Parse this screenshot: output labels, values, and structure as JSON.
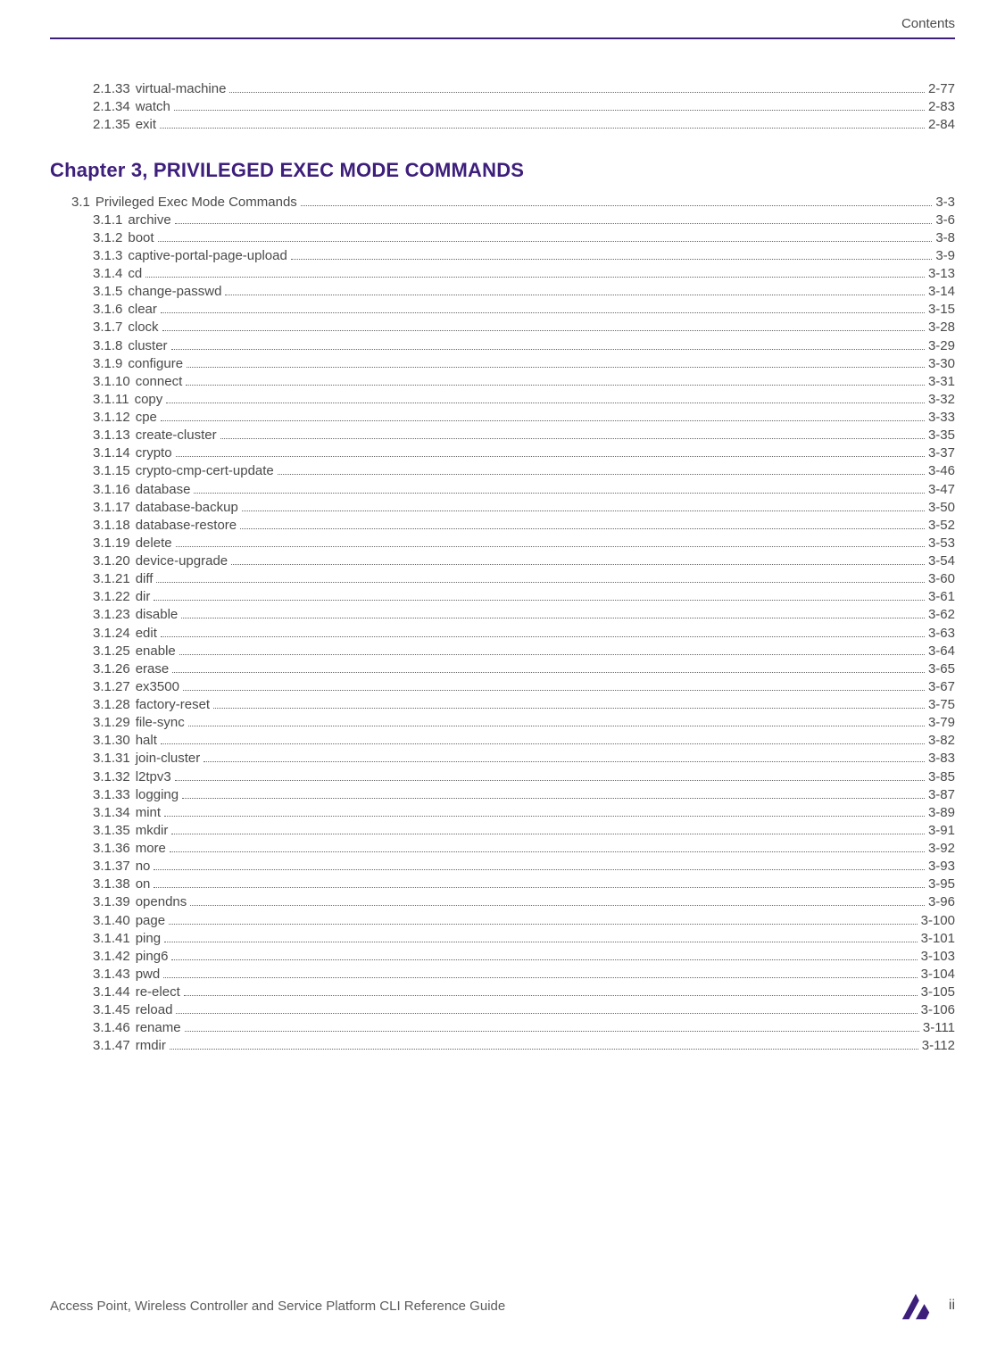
{
  "header": {
    "section_label": "Contents"
  },
  "chapter_heading": "Chapter 3, PRIVILEGED EXEC MODE COMMANDS",
  "toc_pre": [
    {
      "num": "2.1.33",
      "title": "virtual-machine",
      "page": "2-77",
      "indent": 2
    },
    {
      "num": "2.1.34",
      "title": "watch",
      "page": "2-83",
      "indent": 2
    },
    {
      "num": "2.1.35",
      "title": "exit",
      "page": "2-84",
      "indent": 2
    }
  ],
  "toc_post": [
    {
      "num": "3.1",
      "title": "Privileged Exec Mode Commands",
      "page": "3-3",
      "indent": 1
    },
    {
      "num": "3.1.1",
      "title": "archive",
      "page": "3-6",
      "indent": 2
    },
    {
      "num": "3.1.2",
      "title": "boot",
      "page": "3-8",
      "indent": 2
    },
    {
      "num": "3.1.3",
      "title": "captive-portal-page-upload",
      "page": "3-9",
      "indent": 2
    },
    {
      "num": "3.1.4",
      "title": "cd",
      "page": "3-13",
      "indent": 2
    },
    {
      "num": "3.1.5",
      "title": "change-passwd",
      "page": "3-14",
      "indent": 2
    },
    {
      "num": "3.1.6",
      "title": "clear",
      "page": "3-15",
      "indent": 2
    },
    {
      "num": "3.1.7",
      "title": "clock",
      "page": "3-28",
      "indent": 2
    },
    {
      "num": "3.1.8",
      "title": "cluster",
      "page": "3-29",
      "indent": 2
    },
    {
      "num": "3.1.9",
      "title": "configure",
      "page": "3-30",
      "indent": 2
    },
    {
      "num": "3.1.10",
      "title": "connect",
      "page": "3-31",
      "indent": 2
    },
    {
      "num": "3.1.11",
      "title": "copy",
      "page": "3-32",
      "indent": 2
    },
    {
      "num": "3.1.12",
      "title": "cpe",
      "page": "3-33",
      "indent": 2
    },
    {
      "num": "3.1.13",
      "title": "create-cluster",
      "page": "3-35",
      "indent": 2
    },
    {
      "num": "3.1.14",
      "title": "crypto",
      "page": "3-37",
      "indent": 2
    },
    {
      "num": "3.1.15",
      "title": "crypto-cmp-cert-update",
      "page": "3-46",
      "indent": 2
    },
    {
      "num": "3.1.16",
      "title": "database",
      "page": "3-47",
      "indent": 2
    },
    {
      "num": "3.1.17",
      "title": "database-backup",
      "page": "3-50",
      "indent": 2
    },
    {
      "num": "3.1.18",
      "title": "database-restore",
      "page": "3-52",
      "indent": 2
    },
    {
      "num": "3.1.19",
      "title": "delete",
      "page": "3-53",
      "indent": 2
    },
    {
      "num": "3.1.20",
      "title": "device-upgrade",
      "page": "3-54",
      "indent": 2
    },
    {
      "num": "3.1.21",
      "title": "diff",
      "page": "3-60",
      "indent": 2
    },
    {
      "num": "3.1.22",
      "title": "dir",
      "page": "3-61",
      "indent": 2
    },
    {
      "num": "3.1.23",
      "title": "disable",
      "page": "3-62",
      "indent": 2
    },
    {
      "num": "3.1.24",
      "title": "edit",
      "page": "3-63",
      "indent": 2
    },
    {
      "num": "3.1.25",
      "title": "enable",
      "page": "3-64",
      "indent": 2
    },
    {
      "num": "3.1.26",
      "title": "erase",
      "page": "3-65",
      "indent": 2
    },
    {
      "num": "3.1.27",
      "title": "ex3500",
      "page": "3-67",
      "indent": 2
    },
    {
      "num": "3.1.28",
      "title": "factory-reset",
      "page": "3-75",
      "indent": 2
    },
    {
      "num": "3.1.29",
      "title": "file-sync",
      "page": "3-79",
      "indent": 2
    },
    {
      "num": "3.1.30",
      "title": "halt",
      "page": "3-82",
      "indent": 2
    },
    {
      "num": "3.1.31",
      "title": "join-cluster",
      "page": "3-83",
      "indent": 2
    },
    {
      "num": "3.1.32",
      "title": "l2tpv3",
      "page": "3-85",
      "indent": 2
    },
    {
      "num": "3.1.33",
      "title": "logging",
      "page": "3-87",
      "indent": 2
    },
    {
      "num": "3.1.34",
      "title": "mint",
      "page": "3-89",
      "indent": 2
    },
    {
      "num": "3.1.35",
      "title": "mkdir",
      "page": "3-91",
      "indent": 2
    },
    {
      "num": "3.1.36",
      "title": "more",
      "page": "3-92",
      "indent": 2
    },
    {
      "num": "3.1.37",
      "title": "no",
      "page": "3-93",
      "indent": 2
    },
    {
      "num": "3.1.38",
      "title": "on",
      "page": "3-95",
      "indent": 2
    },
    {
      "num": "3.1.39",
      "title": "opendns",
      "page": "3-96",
      "indent": 2
    },
    {
      "num": "3.1.40",
      "title": "page",
      "page": "3-100",
      "indent": 2
    },
    {
      "num": "3.1.41",
      "title": "ping",
      "page": "3-101",
      "indent": 2
    },
    {
      "num": "3.1.42",
      "title": "ping6",
      "page": "3-103",
      "indent": 2
    },
    {
      "num": "3.1.43",
      "title": "pwd",
      "page": "3-104",
      "indent": 2
    },
    {
      "num": "3.1.44",
      "title": "re-elect",
      "page": "3-105",
      "indent": 2
    },
    {
      "num": "3.1.45",
      "title": "reload",
      "page": "3-106",
      "indent": 2
    },
    {
      "num": "3.1.46",
      "title": "rename",
      "page": "3-111",
      "indent": 2
    },
    {
      "num": "3.1.47",
      "title": "rmdir",
      "page": "3-112",
      "indent": 2
    }
  ],
  "footer": {
    "doc_title": "Access Point, Wireless Controller and Service Platform CLI Reference Guide",
    "page_number": "ii"
  }
}
